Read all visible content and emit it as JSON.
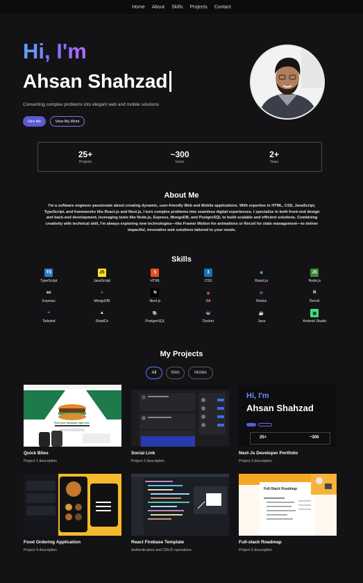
{
  "nav": {
    "items": [
      "Home",
      "About",
      "Skills",
      "Projects",
      "Contact"
    ]
  },
  "hero": {
    "greeting": "Hi, I'm",
    "name": "Ahsan Shahzad",
    "tagline": "Converting complex problems into elegant web and mobile solutions",
    "hire_label": "Hire Me",
    "work_label": "View My Work"
  },
  "stats": [
    {
      "value": "25+",
      "label": "Projects"
    },
    {
      "value": "~300",
      "label": "Users"
    },
    {
      "value": "2+",
      "label": "Years"
    }
  ],
  "about": {
    "title": "About Me",
    "text": "I'm a software engineer passionate about creating dynamic, user-friendly Web and Mobile applications. With expertise in HTML, CSS, JavaScript, TypeScript, and frameworks like React.js and Next.js, I turn complex problems into seamless digital experiences. I specialize in both front-end design and back-end development, leveraging tools like Node.js, Express, MongoDB, and PostgreSQL to build scalable and efficient solutions. Combining creativity with technical skill, I'm always exploring new technologies—like Framer Motion for animations or Recoil for state management—to deliver impactful, innovative web solutions tailored to your needs."
  },
  "skills": {
    "title": "Skills",
    "rows": [
      [
        {
          "name": "TypeScript",
          "icon": "TS",
          "bg": "#3178c6",
          "fg": "#ffffff"
        },
        {
          "name": "JavaScript",
          "icon": "JS",
          "bg": "#f7df1e",
          "fg": "#111111"
        },
        {
          "name": "HTML",
          "icon": "5",
          "bg": "#e34f26",
          "fg": "#ffffff"
        },
        {
          "name": "CSS",
          "icon": "3",
          "bg": "#1572b6",
          "fg": "#ffffff"
        },
        {
          "name": "React.js",
          "icon": "⚛",
          "bg": "transparent",
          "fg": "#61dafb"
        },
        {
          "name": "Node.js",
          "icon": "JS",
          "bg": "#3c873a",
          "fg": "#ffffff"
        }
      ],
      [
        {
          "name": "Express",
          "icon": "ex",
          "bg": "transparent",
          "fg": "#ffffff"
        },
        {
          "name": "MongoDB",
          "icon": "♦",
          "bg": "transparent",
          "fg": "#47a248"
        },
        {
          "name": "Next.js",
          "icon": "N",
          "bg": "#000000",
          "fg": "#ffffff"
        },
        {
          "name": "Git",
          "icon": "◆",
          "bg": "transparent",
          "fg": "#f05032"
        },
        {
          "name": "Redux",
          "icon": "⟳",
          "bg": "transparent",
          "fg": "#9a6cd6"
        },
        {
          "name": "Recoil",
          "icon": "R",
          "bg": "transparent",
          "fg": "#ffffff"
        }
      ],
      [
        {
          "name": "Tailwind",
          "icon": "≈",
          "bg": "transparent",
          "fg": "#38bdf8"
        },
        {
          "name": "ShadCn",
          "icon": "▲",
          "bg": "transparent",
          "fg": "#ffffff"
        },
        {
          "name": "PostgreSQL",
          "icon": "🐘",
          "bg": "transparent",
          "fg": "#4f8fd6"
        },
        {
          "name": "Docker",
          "icon": "🐳",
          "bg": "transparent",
          "fg": "#2496ed"
        },
        {
          "name": "Java",
          "icon": "☕",
          "bg": "transparent",
          "fg": "#e07b28"
        },
        {
          "name": "Android Studio",
          "icon": "▣",
          "bg": "#3ddc84",
          "fg": "#0b3b22"
        }
      ]
    ]
  },
  "projects": {
    "title": "My Projects",
    "filters": [
      "All",
      "Web",
      "Mobile"
    ],
    "active_filter": "All",
    "items": [
      {
        "title": "Quick Bites",
        "desc": "Project 1 description",
        "thumb": "food-app"
      },
      {
        "title": "Social Link",
        "desc": "Project 2 description",
        "thumb": "social"
      },
      {
        "title": "Next-Js Developer Portfolio",
        "desc": "Project 3 description",
        "thumb": "portfolio"
      },
      {
        "title": "Food Ordering Application",
        "desc": "Project 4 description",
        "thumb": "food-order"
      },
      {
        "title": "React Firebase Template",
        "desc": "Authentication and CRUD operations",
        "thumb": "code"
      },
      {
        "title": "Full-stack Roadmap",
        "desc": "Project 5 description",
        "thumb": "roadmap"
      }
    ],
    "thumb_text": {
      "portfolio_hi": "Hi, I'm",
      "portfolio_name": "Ahsan Shahzad",
      "portfolio_stats": [
        "25+",
        "~300"
      ],
      "food_headline": "Find your takeaway right now",
      "roadmap_title": "Full-Stack Roadmap"
    }
  },
  "colors": {
    "accent": "#5b5bd6",
    "background": "#131315"
  }
}
